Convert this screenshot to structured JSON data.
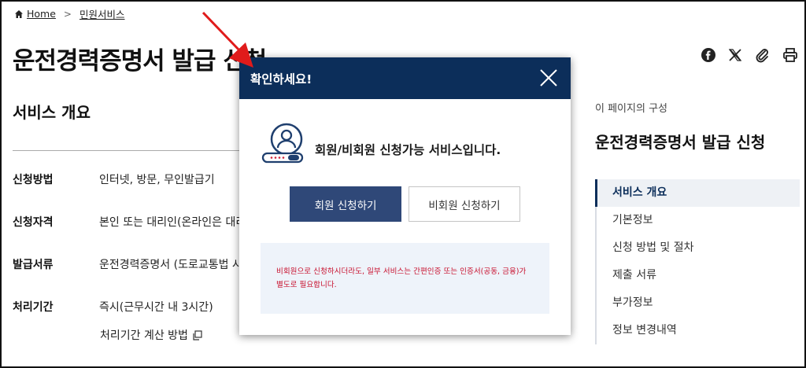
{
  "breadcrumb": {
    "home": "Home",
    "current": "민원서비스",
    "separator": ">"
  },
  "page": {
    "title": "운전경력증명서 발급 신청"
  },
  "service_overview": {
    "heading": "서비스 개요",
    "rows": [
      {
        "label": "신청방법",
        "value": "인터넷, 방문, 무인발급기"
      },
      {
        "label": "신청자격",
        "value": "본인 또는 대리인(온라인은 대리"
      },
      {
        "label": "발급서류",
        "value": "운전경력증명서 (도로교통법 시"
      },
      {
        "label": "처리기간",
        "value": "즉시(근무시간 내 3시간)"
      }
    ],
    "calc_link": "처리기간 계산 방법"
  },
  "toc": {
    "caption": "이 페이지의 구성",
    "title": "운전경력증명서 발급 신청",
    "items": [
      "서비스 개요",
      "기본정보",
      "신청 방법 및 절차",
      "제출 서류",
      "부가정보",
      "정보 변경내역"
    ],
    "active_index": 0
  },
  "share_icons": [
    "facebook-icon",
    "x-icon",
    "paperclip-icon",
    "print-icon"
  ],
  "modal": {
    "title": "확인하세요!",
    "message": "회원/비회원 신청가능 서비스입니다.",
    "member_button": "회원 신청하기",
    "guest_button": "비회원 신청하기",
    "notice_line1": "비회원으로 신청하시더라도, 일부 서비스는 간편인증 또는 인증서(공동, 금융)가",
    "notice_line2": "별도로 필요합니다."
  },
  "colors": {
    "primary": "#0c2e5a",
    "button": "#2f4878",
    "notice_text": "#c8102e",
    "notice_bg": "#eef3fa",
    "annotation_arrow": "#e01b1b"
  }
}
